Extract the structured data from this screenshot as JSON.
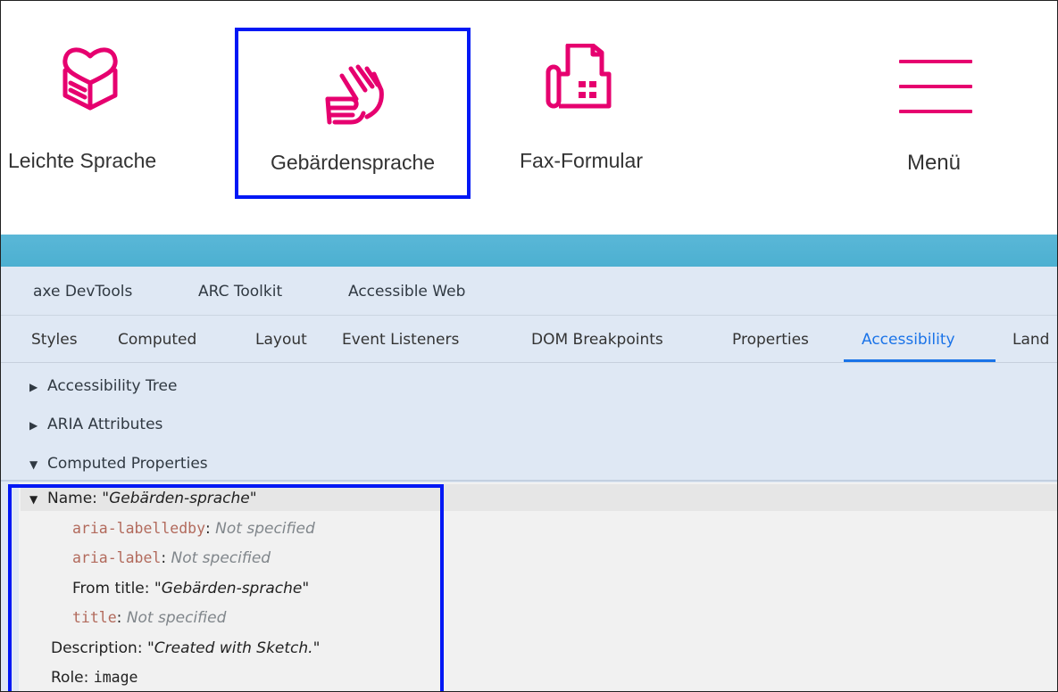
{
  "header": {
    "items": [
      {
        "label": "Leichte Sprache",
        "icon": "easy-language-book-icon"
      },
      {
        "label": "Gebärdensprache",
        "icon": "sign-language-hands-icon"
      },
      {
        "label": "Fax-Formular",
        "icon": "fax-form-icon"
      },
      {
        "label": "Menü",
        "icon": "hamburger-menu-icon"
      }
    ],
    "accent_color": "#e6006f",
    "teal_bar_color": "#52b3d4",
    "highlight_border_color": "#0018f5"
  },
  "devtools": {
    "extension_tabs": [
      "axe DevTools",
      "ARC Toolkit",
      "Accessible Web"
    ],
    "panel_tabs": [
      "Styles",
      "Computed",
      "Layout",
      "Event Listeners",
      "DOM Breakpoints",
      "Properties",
      "Accessibility",
      "Land"
    ],
    "active_tab": "Accessibility",
    "sections": [
      {
        "label": "Accessibility Tree",
        "expanded": false
      },
      {
        "label": "ARIA Attributes",
        "expanded": false
      },
      {
        "label": "Computed Properties",
        "expanded": true
      }
    ],
    "computed": {
      "name_label": "Name: ",
      "name_value": "\"Gebärden-sprache\"",
      "aria_labelledby_key": "aria-labelledby",
      "aria_labelledby_value": "Not specified",
      "aria_label_key": "aria-label",
      "aria_label_value": "Not specified",
      "from_title_label": "From title: ",
      "from_title_value": "\"Gebärden-sprache\"",
      "title_key": "title",
      "title_value": "Not specified",
      "description_label": "Description: ",
      "description_value": "\"Created with Sketch.\"",
      "role_label": "Role: ",
      "role_value": "image"
    }
  }
}
